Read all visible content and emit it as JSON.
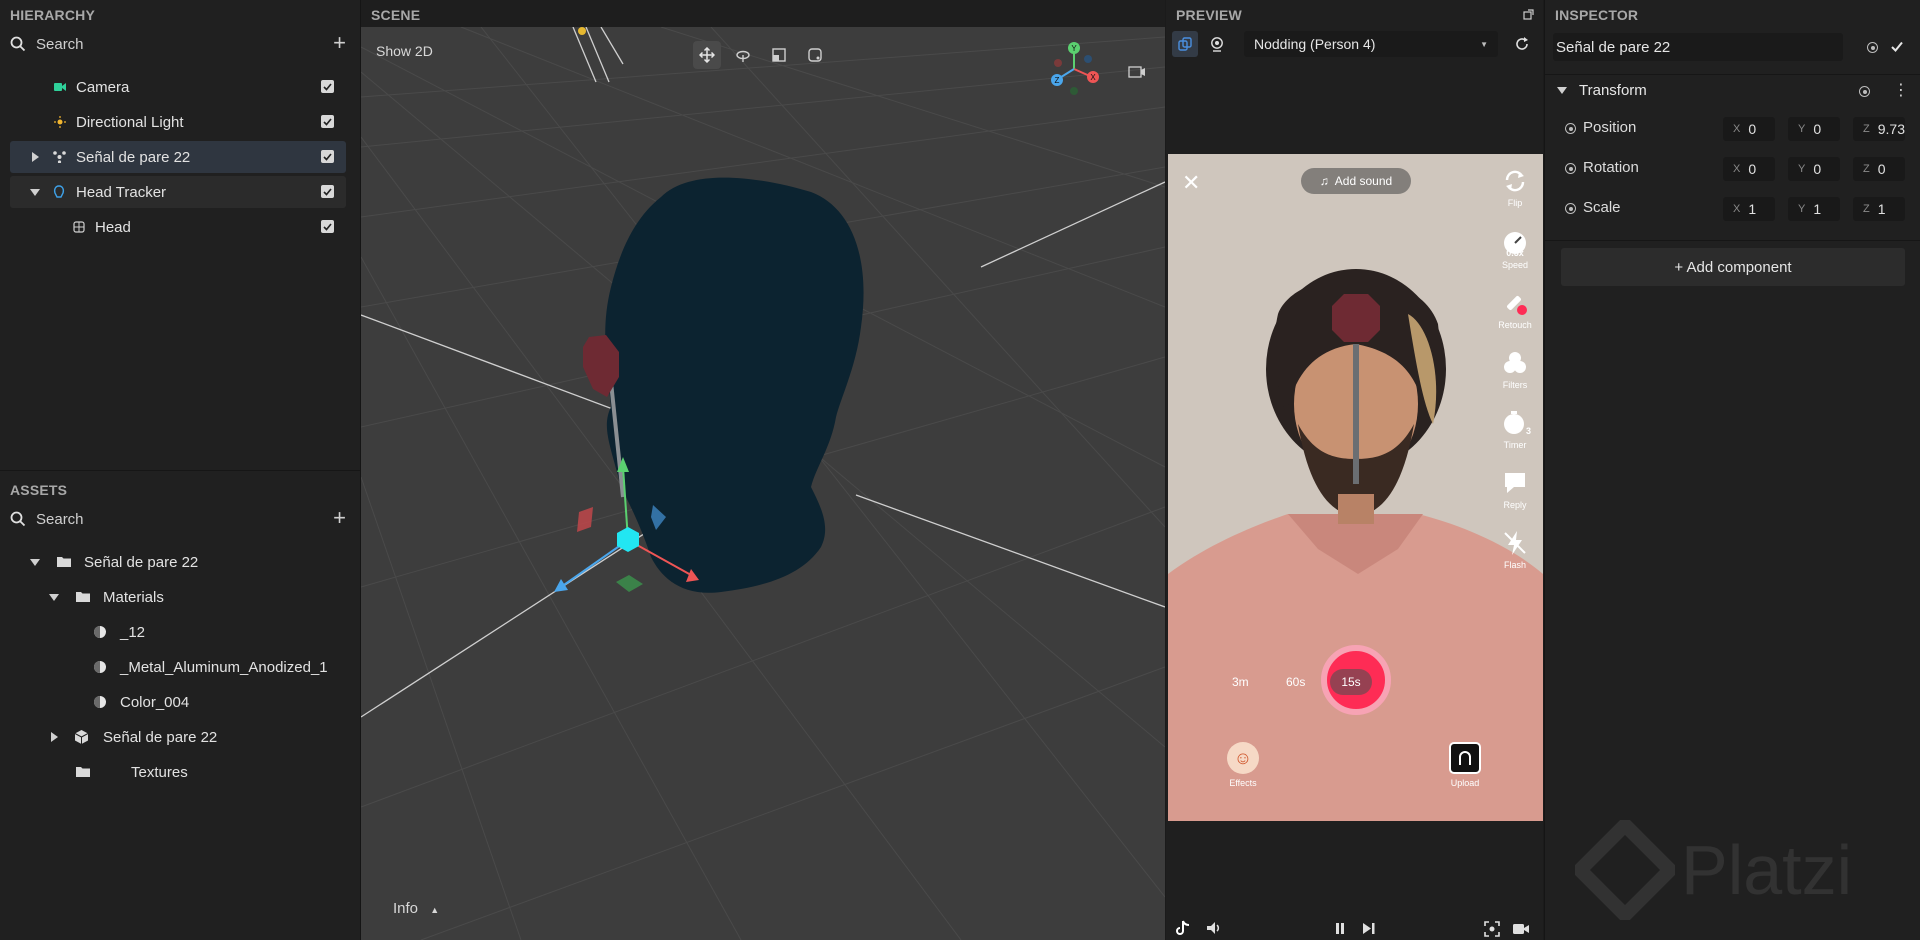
{
  "hierarchy": {
    "title": "HIERARCHY",
    "search_placeholder": "Search",
    "items": [
      {
        "label": "Camera"
      },
      {
        "label": "Directional Light"
      },
      {
        "label": "Señal de pare 22"
      },
      {
        "label": "Head Tracker"
      },
      {
        "label": "Head"
      }
    ]
  },
  "assets": {
    "title": "ASSETS",
    "search_placeholder": "Search",
    "items": [
      {
        "label": "Señal de pare 22"
      },
      {
        "label": "Materials"
      },
      {
        "label": "_12"
      },
      {
        "label": "_Metal_Aluminum_Anodized_1"
      },
      {
        "label": "Color_004"
      },
      {
        "label": "Señal de pare 22"
      },
      {
        "label": "Textures"
      }
    ]
  },
  "scene": {
    "title": "SCENE",
    "show2d_label": "Show 2D",
    "info_label": "Info",
    "gizmo": {
      "y": "Y",
      "x": "X",
      "z": "Z"
    }
  },
  "preview": {
    "title": "PREVIEW",
    "dropdown_value": "Nodding (Person 4)",
    "add_sound_label": "Add sound",
    "side_controls": [
      {
        "label": "Flip",
        "icon": "flip-icon"
      },
      {
        "label": "Speed",
        "icon": "speed-icon",
        "badge": "0.5x"
      },
      {
        "label": "Retouch",
        "icon": "retouch-icon"
      },
      {
        "label": "Filters",
        "icon": "filters-icon"
      },
      {
        "label": "Timer",
        "icon": "timer-icon",
        "badge": "3"
      },
      {
        "label": "Reply",
        "icon": "reply-icon"
      },
      {
        "label": "Flash",
        "icon": "flash-icon"
      }
    ],
    "durations": [
      "3m",
      "60s",
      "15s"
    ],
    "effects_label": "Effects",
    "upload_label": "Upload",
    "record_color": "#fe2c55"
  },
  "inspector": {
    "title": "INSPECTOR",
    "object_name": "Señal de pare 22",
    "transform_label": "Transform",
    "position": {
      "label": "Position",
      "x": "0",
      "y": "0",
      "z": "9.73"
    },
    "rotation": {
      "label": "Rotation",
      "x": "0",
      "y": "0",
      "z": "0"
    },
    "scale": {
      "label": "Scale",
      "x": "1",
      "y": "1",
      "z": "1"
    },
    "axis_labels": {
      "x": "X",
      "y": "Y",
      "z": "Z"
    },
    "add_component_label": "+ Add component",
    "watermark": "Platzi"
  },
  "colors": {
    "accent_blue": "#4a8fe0",
    "head_silhouette": "#0c2330",
    "stop_sign": "#6e2a33",
    "cyan_handle": "#22e6f2"
  }
}
